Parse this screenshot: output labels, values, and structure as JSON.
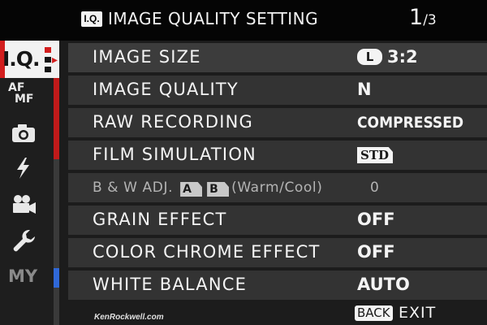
{
  "header": {
    "badge": "I.Q.",
    "title": "IMAGE QUALITY SETTING",
    "page_current": "1",
    "page_total": "/3"
  },
  "tabs": [
    {
      "id": "image-quality",
      "label": "I.Q.",
      "selected": true
    },
    {
      "id": "af-mf",
      "label_top": "AF",
      "label_bottom": "MF"
    },
    {
      "id": "shooting",
      "icon": "camera-icon"
    },
    {
      "id": "flash",
      "icon": "flash-icon"
    },
    {
      "id": "movie",
      "icon": "movie-camera-icon"
    },
    {
      "id": "setup",
      "icon": "wrench-icon"
    },
    {
      "id": "my-menu",
      "label": "MY"
    }
  ],
  "menu": {
    "rows": [
      {
        "label": "IMAGE SIZE",
        "value_badge": "L",
        "value": "3:2",
        "selected": true
      },
      {
        "label": "IMAGE QUALITY",
        "value": "N"
      },
      {
        "label": "RAW RECORDING",
        "value": "COMPRESSED"
      },
      {
        "label": "FILM SIMULATION",
        "value_badge": "STD"
      },
      {
        "label_prefix": "B & W ADJ.",
        "label_chip_a": "A",
        "label_chip_b": "B",
        "label_suffix": "(Warm/Cool)",
        "value": "0",
        "disabled": true
      },
      {
        "label": "GRAIN EFFECT",
        "value": "OFF"
      },
      {
        "label": "COLOR CHROME EFFECT",
        "value": "OFF"
      },
      {
        "label": "WHITE BALANCE",
        "value": "AUTO"
      }
    ]
  },
  "footer": {
    "credit": "KenRockwell.com",
    "back_key": "BACK",
    "exit_label": "EXIT"
  },
  "colors": {
    "accent_red": "#d21e1e",
    "scroll_blue": "#2f68d8",
    "row_bg": "#333333",
    "header_bg": "#050505"
  },
  "scroll": {
    "position_fraction": 0.0,
    "visible_fraction": 0.33
  }
}
